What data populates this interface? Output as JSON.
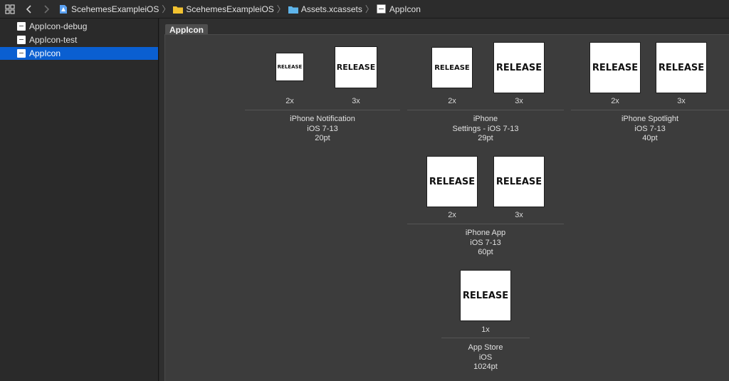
{
  "breadcrumbs": [
    {
      "label": "ScehemesExampleiOS",
      "icon": "project-file-icon"
    },
    {
      "label": "ScehemesExampleiOS",
      "icon": "folder-icon"
    },
    {
      "label": "Assets.xcassets",
      "icon": "asset-catalog-folder-icon"
    },
    {
      "label": "AppIcon",
      "icon": "appicon-set-icon"
    }
  ],
  "sidebar": {
    "items": [
      {
        "label": "AppIcon-debug",
        "selected": false
      },
      {
        "label": "AppIcon-test",
        "selected": false
      },
      {
        "label": "AppIcon",
        "selected": true
      }
    ]
  },
  "main": {
    "set_title": "AppIcon",
    "icon_text": "RELEASE",
    "groups": [
      {
        "name": "iPhone Notification",
        "caption": [
          "iPhone Notification",
          "iOS 7-13",
          "20pt"
        ],
        "slots": [
          {
            "scale": "2x"
          },
          {
            "scale": "3x"
          }
        ]
      },
      {
        "name": "iPhone Settings",
        "caption": [
          "iPhone",
          "Settings - iOS 7-13",
          "29pt"
        ],
        "slots": [
          {
            "scale": "2x"
          },
          {
            "scale": "3x"
          }
        ]
      },
      {
        "name": "iPhone Spotlight",
        "caption": [
          "iPhone Spotlight",
          "iOS 7-13",
          "40pt"
        ],
        "slots": [
          {
            "scale": "2x"
          },
          {
            "scale": "3x"
          }
        ]
      },
      {
        "name": "iPhone App",
        "caption": [
          "iPhone App",
          "iOS 7-13",
          "60pt"
        ],
        "slots": [
          {
            "scale": "2x"
          },
          {
            "scale": "3x"
          }
        ]
      },
      {
        "name": "App Store",
        "caption": [
          "App Store",
          "iOS",
          "1024pt"
        ],
        "slots": [
          {
            "scale": "1x"
          }
        ]
      }
    ]
  },
  "colors": {
    "selection": "#0a5fd1",
    "canvas": "#3c3c3c",
    "sidebar": "#2a2a2a"
  }
}
